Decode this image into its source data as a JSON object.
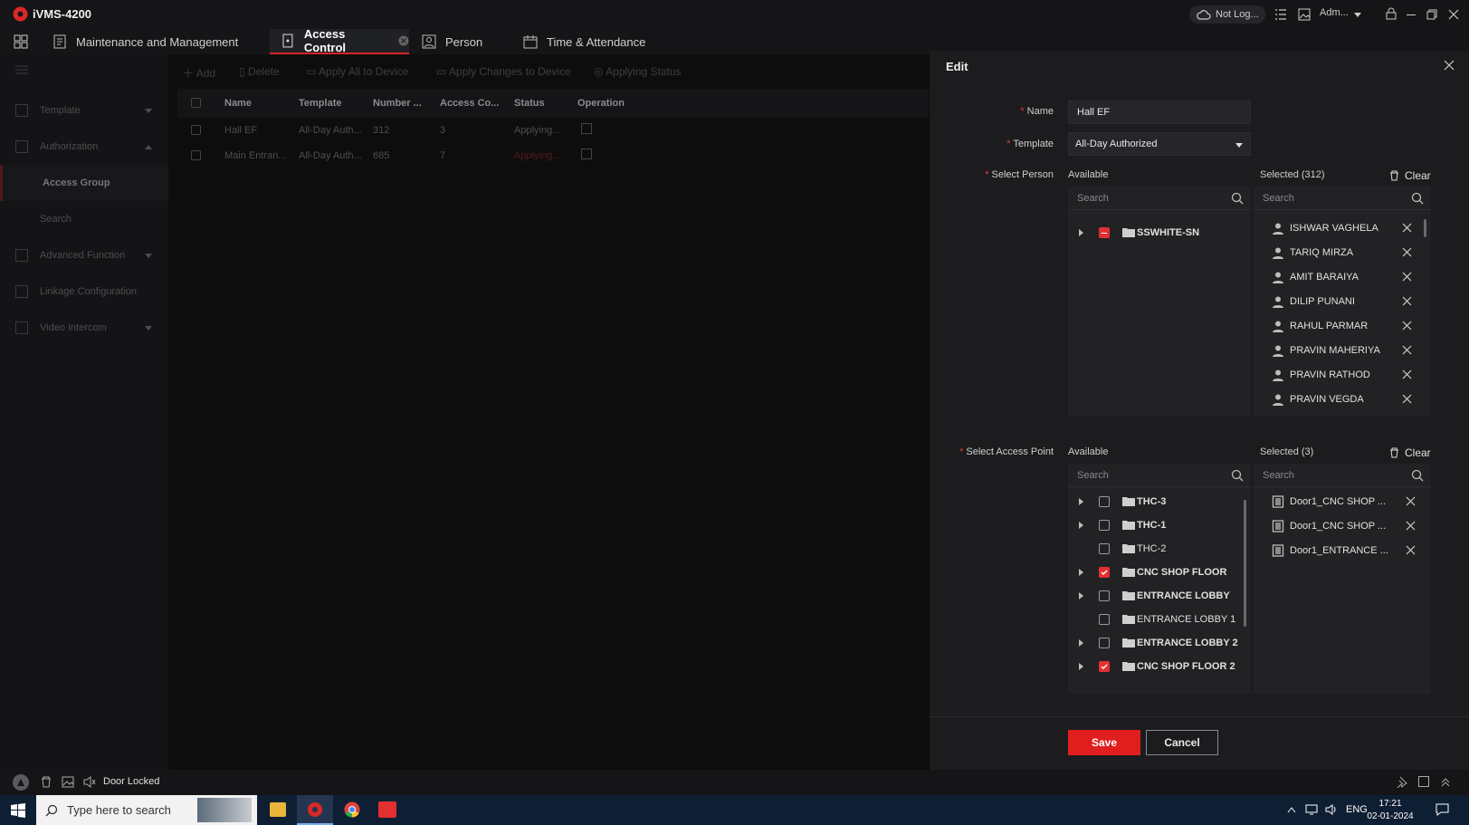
{
  "app": {
    "title": "iVMS-4200",
    "cloud_status": "Not Log...",
    "user": "Adm..."
  },
  "tabs": [
    {
      "label": "Maintenance and Management"
    },
    {
      "label": "Access Control"
    },
    {
      "label": "Person"
    },
    {
      "label": "Time & Attendance"
    }
  ],
  "sidebar": {
    "items": [
      {
        "label": "Template"
      },
      {
        "label": "Authorization"
      },
      {
        "label": "Access Group"
      },
      {
        "label": "Search"
      },
      {
        "label": "Advanced Function"
      },
      {
        "label": "Linkage Configuration"
      },
      {
        "label": "Video Intercom"
      }
    ]
  },
  "toolbar": {
    "add": "Add",
    "delete": "Delete",
    "apply_all": "Apply All to Device",
    "apply_changes": "Apply Changes to Device",
    "applying_status": "Applying Status"
  },
  "table": {
    "headers": [
      "Name",
      "Template",
      "Number ...",
      "Access Co...",
      "Status",
      "Operation"
    ],
    "rows": [
      {
        "name": "Hall EF",
        "template": "All-Day Auth...",
        "number": "312",
        "access": "3",
        "status": "Applying..."
      },
      {
        "name": "Main Entran...",
        "template": "All-Day Auth...",
        "number": "685",
        "access": "7",
        "status": "Applying..."
      }
    ]
  },
  "edit": {
    "title": "Edit",
    "name_label": "Name",
    "name_value": "Hall EF",
    "template_label": "Template",
    "template_value": "All-Day Authorized",
    "person_label": "Select Person",
    "available": "Available",
    "selected_person": "Selected  (312)",
    "clear": "Clear",
    "search_placeholder": "Search",
    "person_tree": [
      {
        "label": "SSWHITE-SN"
      }
    ],
    "selected_persons": [
      "ISHWAR VAGHELA",
      "TARIQ MIRZA",
      "AMIT BARAIYA",
      "DILIP PUNANI",
      "RAHUL PARMAR",
      "PRAVIN MAHERIYA",
      "PRAVIN RATHOD",
      "PRAVIN VEGDA"
    ],
    "access_label": "Select Access Point",
    "selected_access": "Selected  (3)",
    "access_tree": [
      {
        "label": "THC-3",
        "checked": false,
        "expandable": true
      },
      {
        "label": "THC-1",
        "checked": false,
        "expandable": true
      },
      {
        "label": "THC-2",
        "checked": false,
        "expandable": false
      },
      {
        "label": "CNC SHOP FLOOR",
        "checked": true,
        "expandable": true
      },
      {
        "label": "ENTRANCE LOBBY",
        "checked": false,
        "expandable": true
      },
      {
        "label": "ENTRANCE LOBBY 1",
        "checked": false,
        "expandable": false
      },
      {
        "label": "ENTRANCE LOBBY 2",
        "checked": false,
        "expandable": true
      },
      {
        "label": "CNC SHOP FLOOR 2",
        "checked": true,
        "expandable": true
      }
    ],
    "selected_doors": [
      "Door1_CNC SHOP ...",
      "Door1_CNC SHOP ...",
      "Door1_ENTRANCE ..."
    ],
    "save": "Save",
    "cancel": "Cancel"
  },
  "status": {
    "door": "Door Locked"
  },
  "taskbar": {
    "search_placeholder": "Type here to search",
    "lang": "ENG",
    "time": "17:21",
    "date": "02-01-2024"
  },
  "colors": {
    "accent": "#e23030",
    "panel": "#1c1c1e",
    "taskbar": "#0f1f33"
  }
}
